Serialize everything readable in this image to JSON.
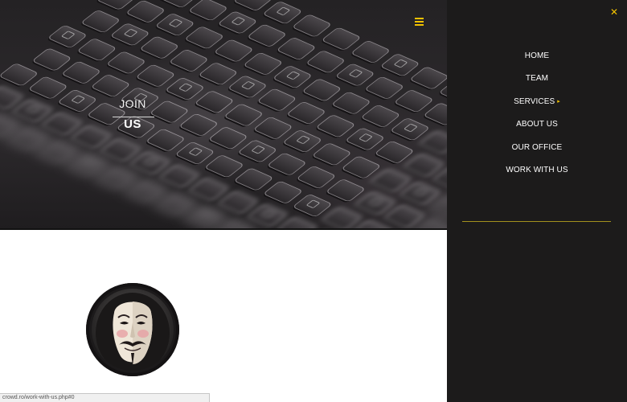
{
  "hero": {
    "title_line1": "JOIN",
    "title_line2": "US"
  },
  "side_menu": {
    "items": [
      {
        "label": "HOME"
      },
      {
        "label": "TEAM"
      },
      {
        "label": "SERVICES",
        "has_submenu": true
      },
      {
        "label": "ABOUT US"
      },
      {
        "label": "OUR OFFICE"
      },
      {
        "label": "WORK WITH US"
      }
    ]
  },
  "status_bar": {
    "url": "crowd.ro/work-with-us.php#0"
  },
  "icons": {
    "menu": "hamburger-icon",
    "close": "close-icon",
    "submenu": "chevron-right-icon",
    "avatar": "guy-fawkes-mask"
  },
  "colors": {
    "accent": "#f2c200",
    "menu_background": "#1c1b1b",
    "menu_text": "#ffffff",
    "divider": "#a3901e",
    "hero_background": "#262426"
  }
}
